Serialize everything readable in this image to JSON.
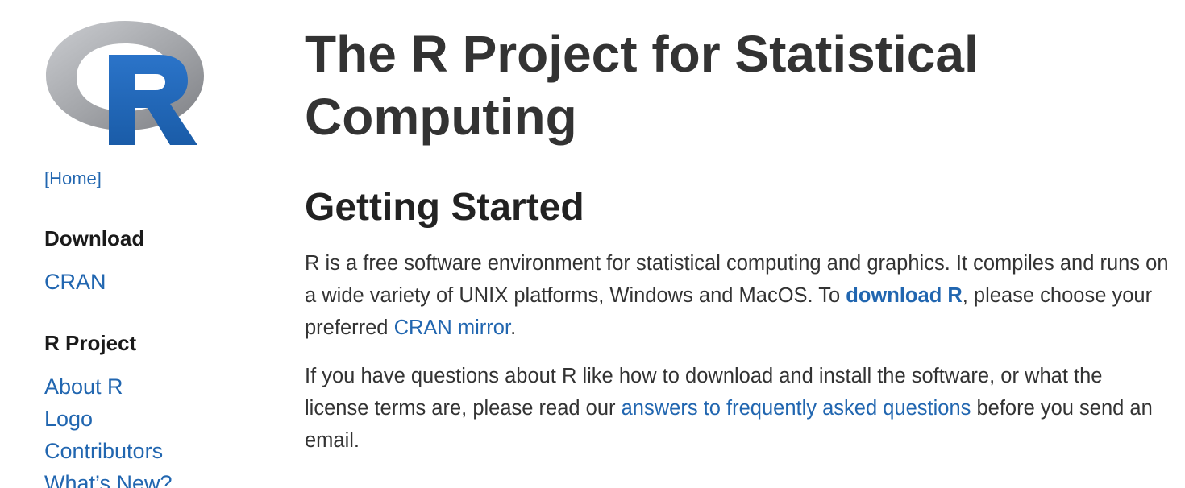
{
  "sidebar": {
    "logo_alt": "R",
    "home_link": "[Home]",
    "sections": [
      {
        "heading": "Download",
        "links": [
          "CRAN"
        ]
      },
      {
        "heading": "R Project",
        "links": [
          "About R",
          "Logo",
          "Contributors",
          "What’s New?"
        ]
      }
    ]
  },
  "main": {
    "title": "The R Project for Statistical Computing",
    "section_title": "Getting Started",
    "para1": {
      "text1": "R is a free software environment for statistical computing and graphics. It compiles and runs on a wide variety of UNIX platforms, Windows and MacOS. To ",
      "link1": "download R",
      "text2": ", please choose your preferred ",
      "link2": "CRAN mirror",
      "text3": "."
    },
    "para2": {
      "text1": "If you have questions about R like how to download and install the software, or what the license terms are, please read our ",
      "link1": "answers to frequently asked questions",
      "text2": " before you send an email."
    }
  },
  "colors": {
    "link": "#2166b0",
    "logo_blue": "#1f65b7",
    "logo_ring_gray": "#a7a9ad",
    "text": "#333333"
  }
}
